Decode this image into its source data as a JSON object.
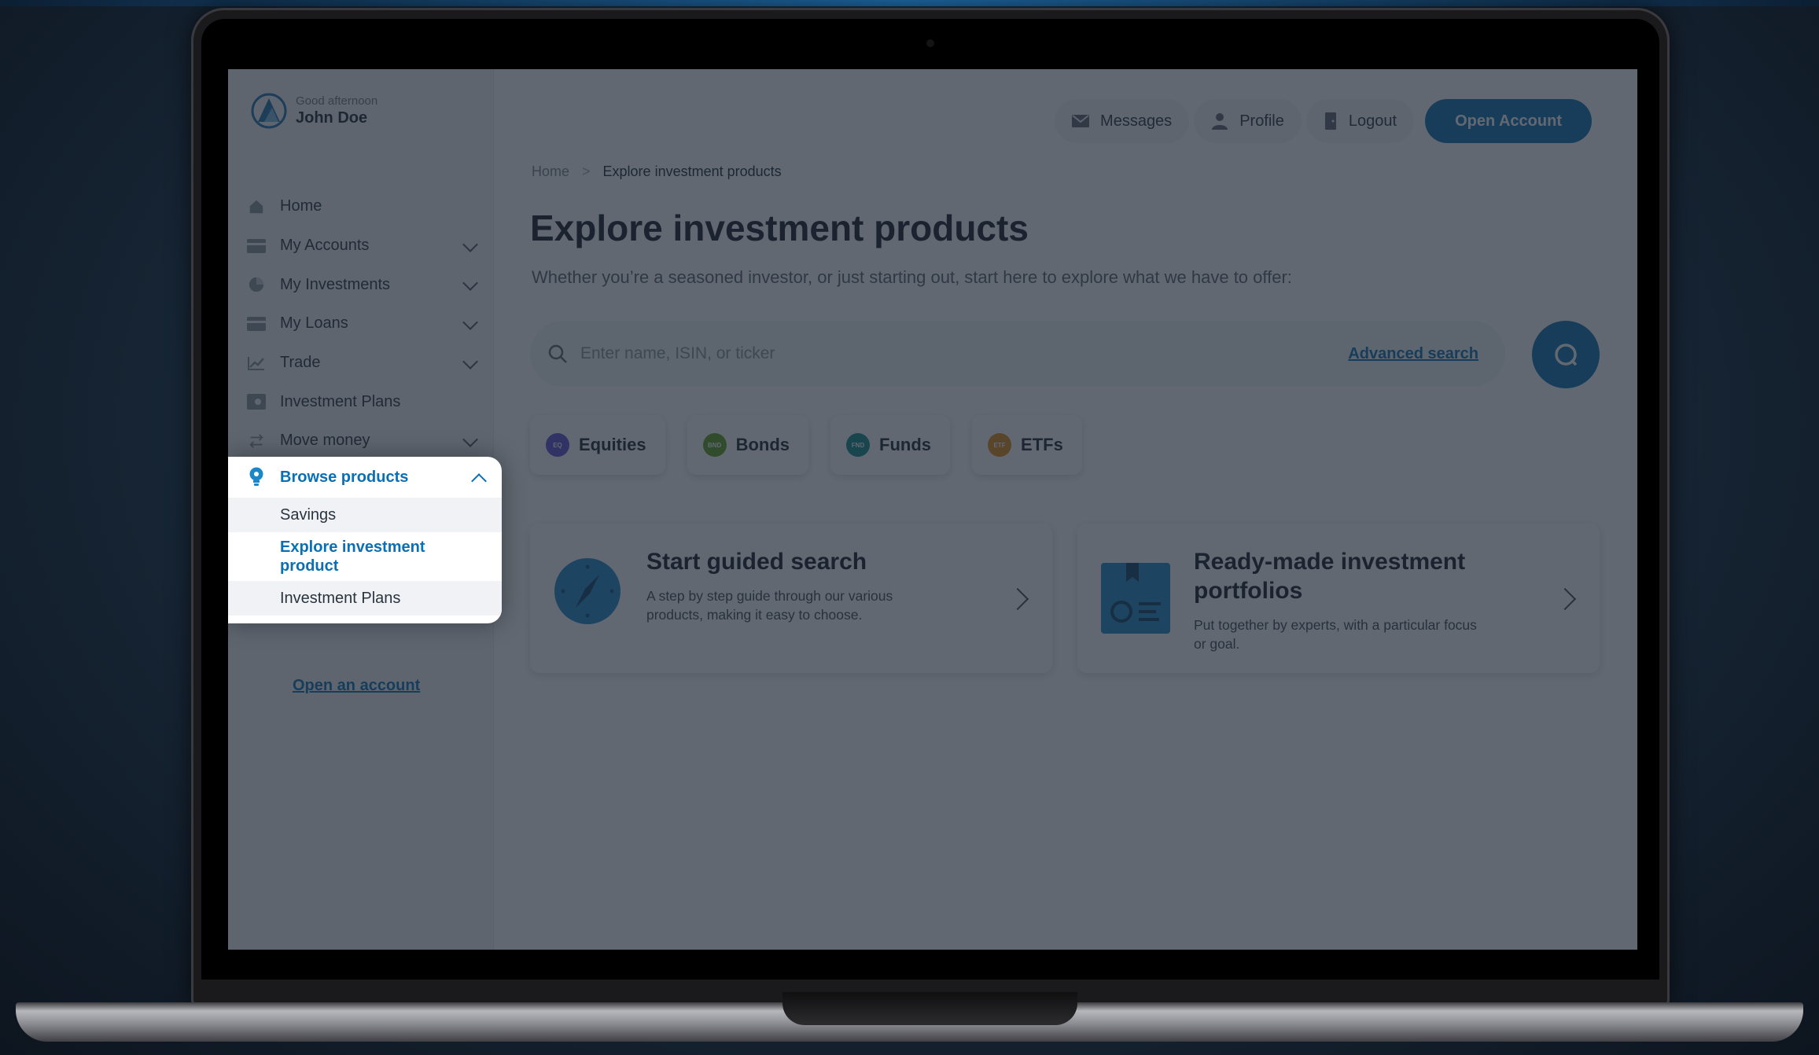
{
  "user": {
    "greeting": "Good afternoon",
    "name": "John Doe"
  },
  "nav": {
    "home": "Home",
    "accounts": "My Accounts",
    "investments": "My Investments",
    "loans": "My Loans",
    "trade": "Trade",
    "plans": "Investment Plans",
    "move_money": "Move money",
    "browse": "Browse products",
    "browse_sub": [
      "Savings",
      "Explore investment product",
      "Investment Plans"
    ]
  },
  "sidebar_footer": {
    "open_account": "Open an account"
  },
  "topbar": {
    "messages": "Messages",
    "profile": "Profile",
    "logout": "Logout",
    "open_account": "Open Account"
  },
  "breadcrumb": {
    "home": "Home",
    "current": "Explore investment products"
  },
  "page": {
    "title": "Explore investment products",
    "subtitle": "Whether you’re a seasoned investor, or just starting out, start here to explore what we have to offer:"
  },
  "search": {
    "placeholder": "Enter name, ISIN, or ticker",
    "advanced": "Advanced search"
  },
  "chips": [
    {
      "badge": "EQ",
      "label": "Equities",
      "color": "#5b4fd1"
    },
    {
      "badge": "BND",
      "label": "Bonds",
      "color": "#5aa21a"
    },
    {
      "badge": "FND",
      "label": "Funds",
      "color": "#0e8a8a"
    },
    {
      "badge": "ETF",
      "label": "ETFs",
      "color": "#e08a12"
    }
  ],
  "cards": [
    {
      "title": "Start guided search",
      "desc": "A step by step guide through our various products, making it easy to choose."
    },
    {
      "title": "Ready-made investment portfolios",
      "desc": "Put together by experts, with a particular focus or goal."
    }
  ],
  "colors": {
    "accent": "#0a6fb3",
    "overlay": "rgba(30,40,52,0.7)"
  }
}
